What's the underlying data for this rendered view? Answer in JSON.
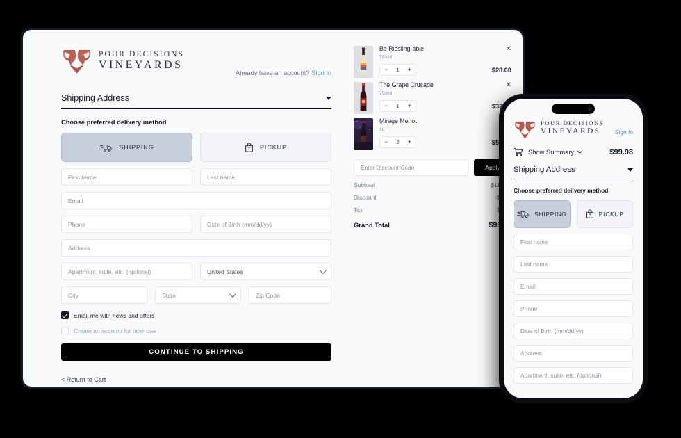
{
  "brand": {
    "line1": "POUR DECISIONS",
    "line2": "VINEYARDS",
    "logo_icon": "two-wine-glasses-heart-logo",
    "logo_color": "#b05a4e"
  },
  "desktop": {
    "account": {
      "prompt": "Already have an account?",
      "signin_label": "Sign In"
    },
    "section": {
      "title": "Shipping Address",
      "caret_icon": "caret-down-icon"
    },
    "delivery": {
      "heading": "Choose preferred delivery method",
      "options": [
        {
          "label": "SHIPPING",
          "icon": "delivery-truck-icon",
          "selected": true
        },
        {
          "label": "PICKUP",
          "icon": "shopping-bag-icon",
          "selected": false
        }
      ]
    },
    "form": {
      "first_name": {
        "placeholder": "First name",
        "value": ""
      },
      "last_name": {
        "placeholder": "Last name",
        "value": ""
      },
      "email": {
        "placeholder": "Email",
        "value": ""
      },
      "phone": {
        "placeholder": "Phone",
        "value": ""
      },
      "dob": {
        "placeholder": "Date of Birth (mm/dd/yy)",
        "value": ""
      },
      "address": {
        "placeholder": "Address",
        "value": ""
      },
      "apartment": {
        "placeholder": "Apartment, suite, etc. (optional)",
        "value": ""
      },
      "country": {
        "value": "United States",
        "icon": "chevron-down-icon"
      },
      "city": {
        "placeholder": "City",
        "value": ""
      },
      "state": {
        "value": "State",
        "icon": "chevron-down-icon"
      },
      "zip": {
        "placeholder": "Zip Code",
        "value": ""
      }
    },
    "checkboxes": [
      {
        "label": "Email me with news and offers",
        "checked": true
      },
      {
        "label": "Create an account for later use",
        "checked": false
      }
    ],
    "cta_label": "CONTINUE TO SHIPPING",
    "return_label": "< Return to Cart"
  },
  "cart": {
    "items": [
      {
        "name": "Be Riesling-able",
        "size": "750ml",
        "qty": "1",
        "price": "$28.00",
        "remove_icon": "close-icon",
        "minus": "−",
        "plus": "+",
        "thumb": "white-wine-bottle"
      },
      {
        "name": "The Grape Crusade",
        "size": "750ml",
        "qty": "1",
        "price": "$32.50",
        "remove_icon": "close-icon",
        "minus": "−",
        "plus": "+",
        "thumb": "red-wine-bottle"
      },
      {
        "name": "Mirage Merlot",
        "size": "1L",
        "qty": "2",
        "price": "$52.00",
        "remove_icon": "close-icon",
        "minus": "−",
        "plus": "+",
        "thumb": "merlot-bottle-cosmic"
      }
    ],
    "discount": {
      "placeholder": "Enter Discount Code",
      "value": "",
      "apply_label": "Apply"
    },
    "totals": [
      {
        "label": "Subtotal",
        "value": "$112.50"
      },
      {
        "label": "Discount",
        "value": "-$4.99"
      },
      {
        "label": "Tax",
        "value": "$7.53"
      }
    ],
    "grand": {
      "label": "Grand Total",
      "value": "$99.98"
    }
  },
  "phone": {
    "signin_label": "Sign In",
    "summary": {
      "label": "Show Summary",
      "amount": "$99.98",
      "cart_icon": "shopping-cart-icon",
      "chevron_icon": "chevron-down-icon"
    },
    "section": {
      "title": "Shipping Address",
      "caret_icon": "caret-down-icon"
    },
    "delivery": {
      "heading": "Choose preferred delivery method",
      "options": [
        {
          "label": "SHIPPING",
          "icon": "delivery-truck-icon",
          "selected": true
        },
        {
          "label": "PICKUP",
          "icon": "shopping-bag-icon",
          "selected": false
        }
      ]
    },
    "form": {
      "first_name": {
        "placeholder": "First name"
      },
      "last_name": {
        "placeholder": "Last name"
      },
      "email": {
        "placeholder": "Email"
      },
      "phone": {
        "placeholder": "Phone"
      },
      "dob": {
        "placeholder": "Date of Birth (mm/dd/yy)"
      },
      "address": {
        "placeholder": "Address"
      },
      "apartment": {
        "placeholder": "Apartment, suite, etc. (optional)"
      }
    }
  }
}
